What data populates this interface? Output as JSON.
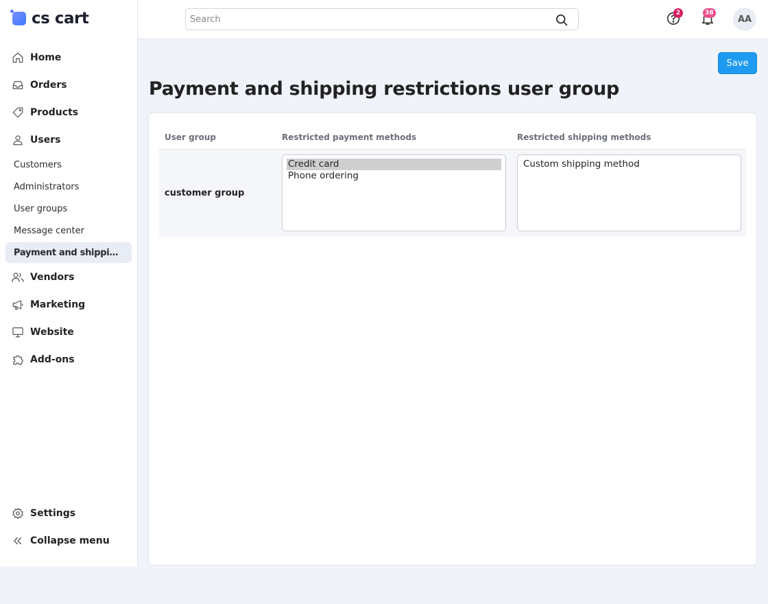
{
  "app": {
    "logo_text": "cs cart"
  },
  "sidebar": {
    "items": [
      {
        "label": "Home",
        "icon": "home-icon"
      },
      {
        "label": "Orders",
        "icon": "inbox-icon"
      },
      {
        "label": "Products",
        "icon": "tag-icon"
      },
      {
        "label": "Users",
        "icon": "user-icon"
      },
      {
        "label": "Vendors",
        "icon": "users-icon"
      },
      {
        "label": "Marketing",
        "icon": "megaphone-icon"
      },
      {
        "label": "Website",
        "icon": "monitor-icon"
      },
      {
        "label": "Add-ons",
        "icon": "puzzle-icon"
      }
    ],
    "users_sub": [
      {
        "label": "Customers"
      },
      {
        "label": "Administrators"
      },
      {
        "label": "User groups"
      },
      {
        "label": "Message center"
      },
      {
        "label": "Payment and shipping restrictions user group",
        "active": true
      }
    ],
    "settings_label": "Settings",
    "collapse_label": "Collapse menu"
  },
  "header": {
    "search_placeholder": "Search",
    "help_count": "2",
    "notifications_count": "38",
    "avatar_initials": "AA"
  },
  "toolbar": {
    "save_label": "Save"
  },
  "page": {
    "title": "Payment and shipping restrictions user group"
  },
  "table": {
    "headers": [
      "User group",
      "Restricted payment methods",
      "Restricted shipping methods"
    ],
    "rows": [
      {
        "user_group": "customer group",
        "payment_methods": [
          {
            "label": "Credit card",
            "selected": true
          },
          {
            "label": "Phone ordering",
            "selected": false
          }
        ],
        "shipping_methods": [
          {
            "label": "Custom shipping method",
            "selected": false
          }
        ]
      }
    ]
  },
  "colors": {
    "accent": "#1e9bf0",
    "help_badge": "#d81b60",
    "notif_badge": "#ec4f8c",
    "background": "#f0f3fa"
  }
}
